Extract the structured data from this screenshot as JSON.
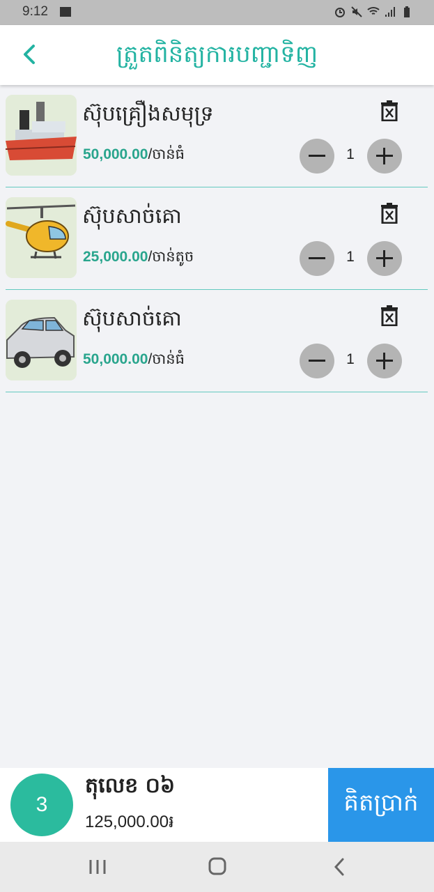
{
  "status_bar": {
    "time": "9:12",
    "icons": [
      "image-icon",
      "alarm-icon",
      "mute-icon",
      "wifi-icon",
      "signal-icon",
      "battery-icon"
    ]
  },
  "header": {
    "title": "ត្រួតពិនិត្យការបញ្ជាទិញ",
    "back_icon": "chevron-left-icon"
  },
  "cart": {
    "items": [
      {
        "name": "ស៊ុបគ្រឿងសមុទ្រ",
        "price": "50,000.00",
        "unit": "/ចាន់ធំ",
        "qty": "1",
        "image": "ship-image"
      },
      {
        "name": "ស៊ុបសាច់គោ",
        "price": "25,000.00",
        "unit": "/ចាន់តូច",
        "qty": "1",
        "image": "helicopter-image"
      },
      {
        "name": "ស៊ុបសាច់គោ",
        "price": "50,000.00",
        "unit": "/ចាន់ធំ",
        "qty": "1",
        "image": "car-image"
      }
    ]
  },
  "summary": {
    "item_count": "3",
    "table_label": "តុលេខ ០៦",
    "total": "125,000.00៛",
    "checkout_label": "គិតប្រាក់"
  },
  "colors": {
    "accent": "#23b3a2",
    "price": "#29a58d",
    "checkout": "#2a96e9",
    "badge": "#2bbb9e"
  }
}
